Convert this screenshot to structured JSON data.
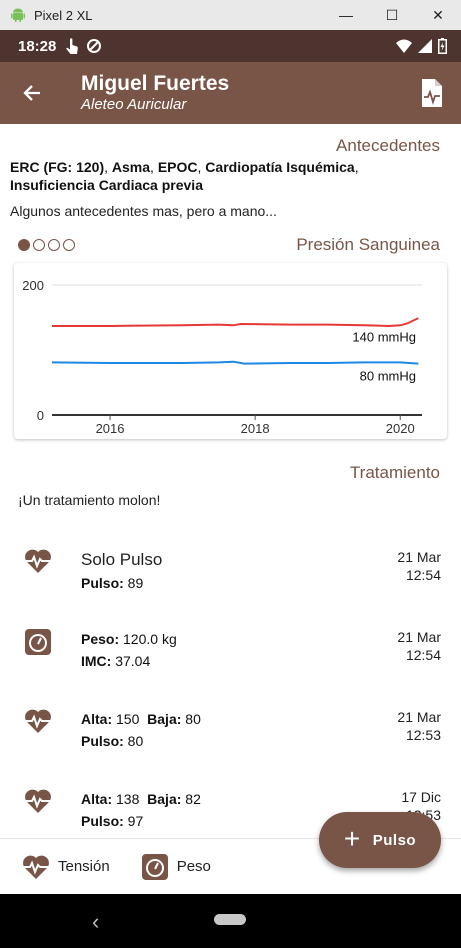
{
  "window": {
    "title": "Pixel 2 XL",
    "minimize": "—",
    "maximize": "☐",
    "close": "✕"
  },
  "status": {
    "time": "18:28"
  },
  "appbar": {
    "name": "Miguel Fuertes",
    "diagnosis": "Aleteo Auricular"
  },
  "antecedentes": {
    "title": "Antecedentes",
    "items": [
      {
        "label": "ERC (FG: 120)",
        "sep": ", "
      },
      {
        "label": "Asma",
        "sep": ", "
      },
      {
        "label": "EPOC",
        "sep": ", "
      },
      {
        "label": "Cardiopatía Isquémica",
        "sep": ", "
      },
      {
        "label": "Insuficiencia Cardiaca previa",
        "sep": ""
      }
    ],
    "note": "Algunos antecedentes mas, pero a mano..."
  },
  "chart_title": "Presión Sanguinea",
  "chart_data": {
    "type": "line",
    "title": "Presión Sanguinea",
    "xlim": [
      2015.2,
      2020.3
    ],
    "ylim": [
      0,
      200
    ],
    "yticks": [
      0,
      200
    ],
    "xticks": [
      "2016",
      "2018",
      "2020"
    ],
    "grid": true,
    "series": [
      {
        "name": "140 mmHg",
        "color": "#e53935",
        "x": [
          2015.2,
          2016.0,
          2017.0,
          2017.5,
          2017.7,
          2017.8,
          2018.5,
          2019.0,
          2019.5,
          2019.85,
          2020.0,
          2020.1,
          2020.25
        ],
        "y": [
          137,
          137,
          138,
          139,
          138,
          140,
          139,
          139,
          138,
          137,
          138,
          141,
          149
        ]
      },
      {
        "name": "80 mmHg",
        "color": "#1e88e5",
        "x": [
          2015.2,
          2016.0,
          2017.0,
          2017.5,
          2017.7,
          2017.85,
          2018.5,
          2019.0,
          2019.5,
          2020.0,
          2020.25
        ],
        "y": [
          81,
          80,
          80,
          81,
          82,
          79,
          80,
          80,
          81,
          81,
          79
        ]
      }
    ]
  },
  "tratamiento": {
    "title": "Tratamiento",
    "text": "¡Un tratamiento molon!"
  },
  "entries": [
    {
      "icon": "heart-pulse-icon",
      "title": "Solo Pulso",
      "line2": [
        {
          "k": "Pulso:",
          "v": " 89"
        }
      ],
      "date": "21 Mar",
      "time": "12:54"
    },
    {
      "icon": "scale-icon",
      "line1": [
        {
          "k": "Peso:",
          "v": " 120.0 kg"
        }
      ],
      "line2": [
        {
          "k": "IMC:",
          "v": " 37.04"
        }
      ],
      "date": "21 Mar",
      "time": "12:54"
    },
    {
      "icon": "heart-pulse-icon",
      "line1": [
        {
          "k": "Alta:",
          "v": " 150  "
        },
        {
          "k": "Baja:",
          "v": " 80"
        }
      ],
      "line2": [
        {
          "k": "Pulso:",
          "v": " 80"
        }
      ],
      "date": "21 Mar",
      "time": "12:53"
    },
    {
      "icon": "heart-pulse-icon",
      "line1": [
        {
          "k": "Alta:",
          "v": " 138  "
        },
        {
          "k": "Baja:",
          "v": " 82"
        }
      ],
      "line2": [
        {
          "k": "Pulso:",
          "v": " 97"
        }
      ],
      "date": "17 Dic",
      "time": "12:53"
    }
  ],
  "bottom": {
    "tension": "Tensión",
    "peso": "Peso"
  },
  "fab": {
    "label": "Pulso",
    "plus": "+"
  },
  "colors": {
    "primary": "#795548",
    "primary_dark": "#4e342e"
  }
}
